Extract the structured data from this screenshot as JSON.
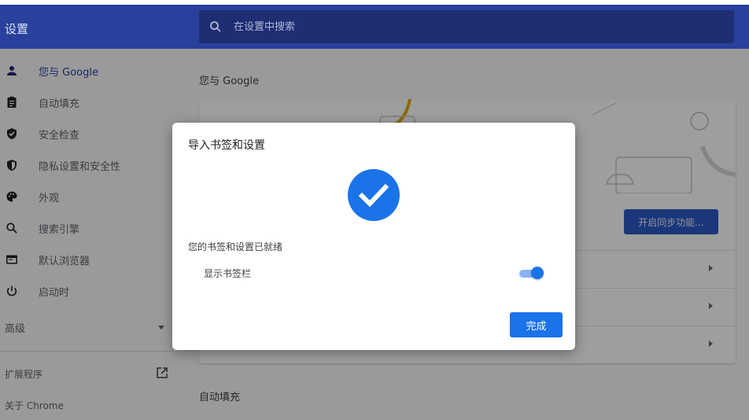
{
  "header": {
    "title": "设置",
    "search_placeholder": "在设置中搜索"
  },
  "sidebar": {
    "items": [
      {
        "label": "您与 Google",
        "icon": "person-icon",
        "active": true
      },
      {
        "label": "自动填充",
        "icon": "clipboard-icon"
      },
      {
        "label": "安全检查",
        "icon": "shield-check-icon"
      },
      {
        "label": "隐私设置和安全性",
        "icon": "privacy-shield-icon"
      },
      {
        "label": "外观",
        "icon": "palette-icon"
      },
      {
        "label": "搜索引擎",
        "icon": "search-icon"
      },
      {
        "label": "默认浏览器",
        "icon": "browser-window-icon"
      },
      {
        "label": "启动时",
        "icon": "power-icon"
      }
    ],
    "advanced": "高级",
    "extensions": "扩展程序",
    "about": "关于 Chrome"
  },
  "main": {
    "section_you_google": "您与 Google",
    "sync_button": "开启同步功能...",
    "section_autofill": "自动填充"
  },
  "dialog": {
    "title": "导入书签和设置",
    "ready_text": "您的书签和设置已就绪",
    "show_bookmarks_bar": "显示书签栏",
    "show_bookmarks_bar_on": true,
    "done_button": "完成"
  },
  "colors": {
    "header_bg": "#29409c",
    "accent": "#1a73e8",
    "sync_button_bg": "#2a59c7"
  }
}
